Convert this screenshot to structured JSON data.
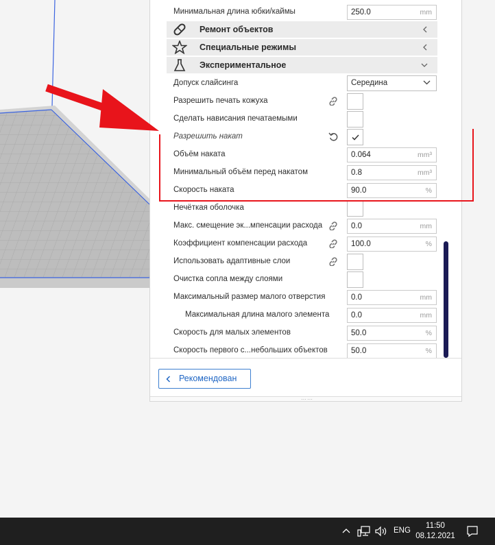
{
  "settings": {
    "skirt_min_length": {
      "label": "Минимальная длина юбки/каймы",
      "value": "250.0",
      "unit": "mm"
    },
    "categories": {
      "mesh_fix": {
        "label": "Ремонт объектов",
        "icon": "bandage-icon"
      },
      "special_modes": {
        "label": "Специальные режимы",
        "icon": "star-icon"
      },
      "experimental": {
        "label": "Экспериментальное",
        "icon": "flask-icon"
      }
    },
    "slicing_tolerance": {
      "label": "Допуск слайсинга",
      "value": "Середина"
    },
    "support_skin": {
      "label": "Разрешить печать кожуха"
    },
    "overhang_printable": {
      "label": "Сделать нависания печатаемыми"
    },
    "coasting_enable": {
      "label": "Разрешить накат",
      "checked": true
    },
    "coasting_volume": {
      "label": "Объём наката",
      "value": "0.064",
      "unit": "mm³"
    },
    "coasting_min_volume": {
      "label": "Минимальный объём перед накатом",
      "value": "0.8",
      "unit": "mm³"
    },
    "coasting_speed": {
      "label": "Скорость наката",
      "value": "90.0",
      "unit": "%"
    },
    "fuzzy_skin": {
      "label": "Нечёткая оболочка"
    },
    "flow_comp_max_offset": {
      "label": "Макс. смещение эк...мпенсации расхода",
      "value": "0.0",
      "unit": "mm"
    },
    "flow_comp_factor": {
      "label": "Коэффициент компенсации расхода",
      "value": "100.0",
      "unit": "%"
    },
    "adaptive_layers": {
      "label": "Использовать адаптивные слои"
    },
    "clean_between_layers": {
      "label": "Очистка сопла между слоями"
    },
    "small_hole_max": {
      "label": "Максимальный размер малого отверстия",
      "value": "0.0",
      "unit": "mm"
    },
    "small_feature_max_length": {
      "label": "Максимальная длина малого элемента",
      "value": "0.0",
      "unit": "mm"
    },
    "small_feature_speed": {
      "label": "Скорость для малых элементов",
      "value": "50.0",
      "unit": "%"
    },
    "small_feature_first_layer_speed": {
      "label": "Скорость первого с...небольших объектов",
      "value": "50.0",
      "unit": "%"
    }
  },
  "footer": {
    "recommended_label": "Рекомендован"
  },
  "taskbar": {
    "lang": "ENG",
    "time": "11:50",
    "date": "08.12.2021"
  },
  "colors": {
    "accent": "#1f66c4",
    "annotation": "#e8141b",
    "scrollbar": "#1b1b55"
  }
}
